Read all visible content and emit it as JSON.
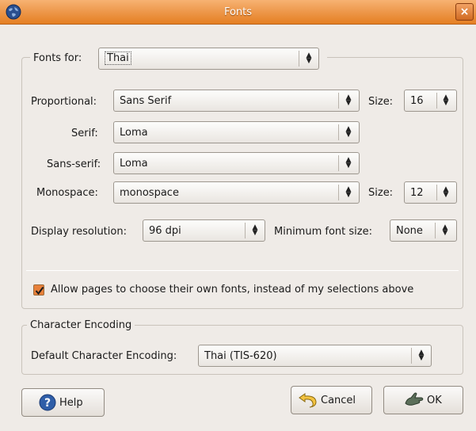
{
  "window": {
    "title": "Fonts",
    "close_glyph": "×"
  },
  "fonts_for": {
    "label": "Fonts for:",
    "value": "Thai"
  },
  "proportional": {
    "label": "Proportional:",
    "value": "Sans Serif",
    "size_label": "Size:",
    "size_value": "16"
  },
  "serif": {
    "label": "Serif:",
    "value": "Loma"
  },
  "sans_serif": {
    "label": "Sans-serif:",
    "value": "Loma"
  },
  "monospace": {
    "label": "Monospace:",
    "value": "monospace",
    "size_label": "Size:",
    "size_value": "12"
  },
  "display_resolution": {
    "label": "Display resolution:",
    "value": "96 dpi"
  },
  "minimum_font_size": {
    "label": "Minimum font size:",
    "value": "None"
  },
  "allow_pages": {
    "label": "Allow pages to choose their own fonts, instead of my selections above",
    "checked": true
  },
  "character_encoding": {
    "legend": "Character Encoding",
    "label": "Default Character Encoding:",
    "value": "Thai (TIS-620)"
  },
  "buttons": {
    "help": "Help",
    "cancel": "Cancel",
    "ok": "OK"
  },
  "icons": [
    "globe-icon",
    "close-icon",
    "help-icon",
    "undo-icon",
    "ok-hand-icon",
    "checkmark-icon"
  ],
  "colors": {
    "titlebar": "#ee9a4e",
    "accent": "#e8803a",
    "window_bg": "#efebe7"
  }
}
